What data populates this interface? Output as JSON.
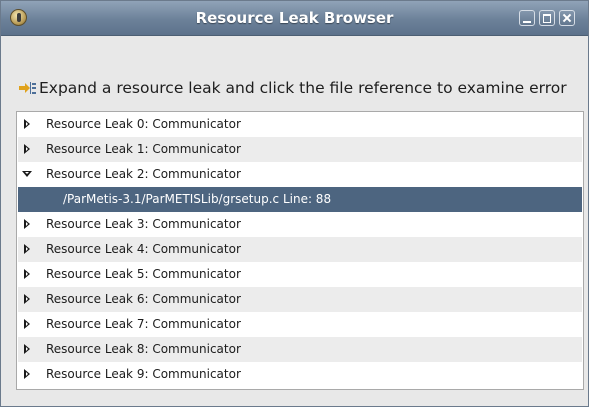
{
  "window": {
    "title": "Resource Leak Browser",
    "accent": "#6c8199",
    "selected_color": "#4d6580"
  },
  "instruction": {
    "icon": "expand-tree-icon",
    "text": "Expand a resource leak and click the file reference to examine error"
  },
  "tree": {
    "items": [
      {
        "label": "Resource Leak 0: Communicator",
        "state": "collapsed"
      },
      {
        "label": "Resource Leak 1: Communicator",
        "state": "collapsed"
      },
      {
        "label": "Resource Leak 2: Communicator",
        "state": "expanded"
      },
      {
        "label": "/ParMetis-3.1/ParMETISLib/grsetup.c Line: 88",
        "state": "child-selected"
      },
      {
        "label": "Resource Leak 3: Communicator",
        "state": "collapsed"
      },
      {
        "label": "Resource Leak 4: Communicator",
        "state": "collapsed"
      },
      {
        "label": "Resource Leak 5: Communicator",
        "state": "collapsed"
      },
      {
        "label": "Resource Leak 6: Communicator",
        "state": "collapsed"
      },
      {
        "label": "Resource Leak 7: Communicator",
        "state": "collapsed"
      },
      {
        "label": "Resource Leak 8: Communicator",
        "state": "collapsed"
      },
      {
        "label": "Resource Leak 9: Communicator",
        "state": "collapsed"
      }
    ]
  }
}
